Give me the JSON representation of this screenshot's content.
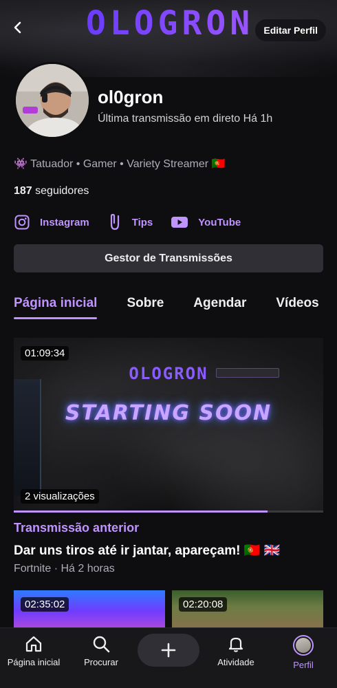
{
  "header": {
    "banner_logo_text": "OLOGRON",
    "edit_label": "Editar Perfil"
  },
  "profile": {
    "name": "ol0gron",
    "last_live": "Última transmissão em direto Há 1h",
    "bio": "👾 Tatuador • Gamer • Variety Streamer 🇵🇹",
    "followers_count": "187",
    "followers_label": "seguidores"
  },
  "socials": [
    {
      "label": "Instagram",
      "icon": "instagram-icon"
    },
    {
      "label": "Tips",
      "icon": "tips-icon"
    },
    {
      "label": "YouTube",
      "icon": "youtube-icon"
    }
  ],
  "manager_button": "Gestor de Transmissões",
  "tabs": [
    {
      "label": "Página inicial",
      "active": true
    },
    {
      "label": "Sobre",
      "active": false
    },
    {
      "label": "Agendar",
      "active": false
    },
    {
      "label": "Vídeos",
      "active": false
    }
  ],
  "featured": {
    "duration": "01:09:34",
    "views": "2 visualizações",
    "overlay_logo": "OLOGRON",
    "overlay_text": "STARTING SOON",
    "progress_fraction": 0.82,
    "section_label": "Transmissão anterior",
    "title": "Dar uns tiros até ir jantar, apareçam! 🇵🇹 🇬🇧",
    "meta": "Fortnite · Há 2 horas"
  },
  "more_videos": [
    {
      "duration": "02:35:02"
    },
    {
      "duration": "02:20:08"
    }
  ],
  "nav": {
    "home": "Página inicial",
    "search": "Procurar",
    "activity": "Atividade",
    "profile": "Perfil"
  },
  "colors": {
    "accent": "#bf94ff",
    "background": "#0e0e10",
    "button": "#2f2f35"
  }
}
